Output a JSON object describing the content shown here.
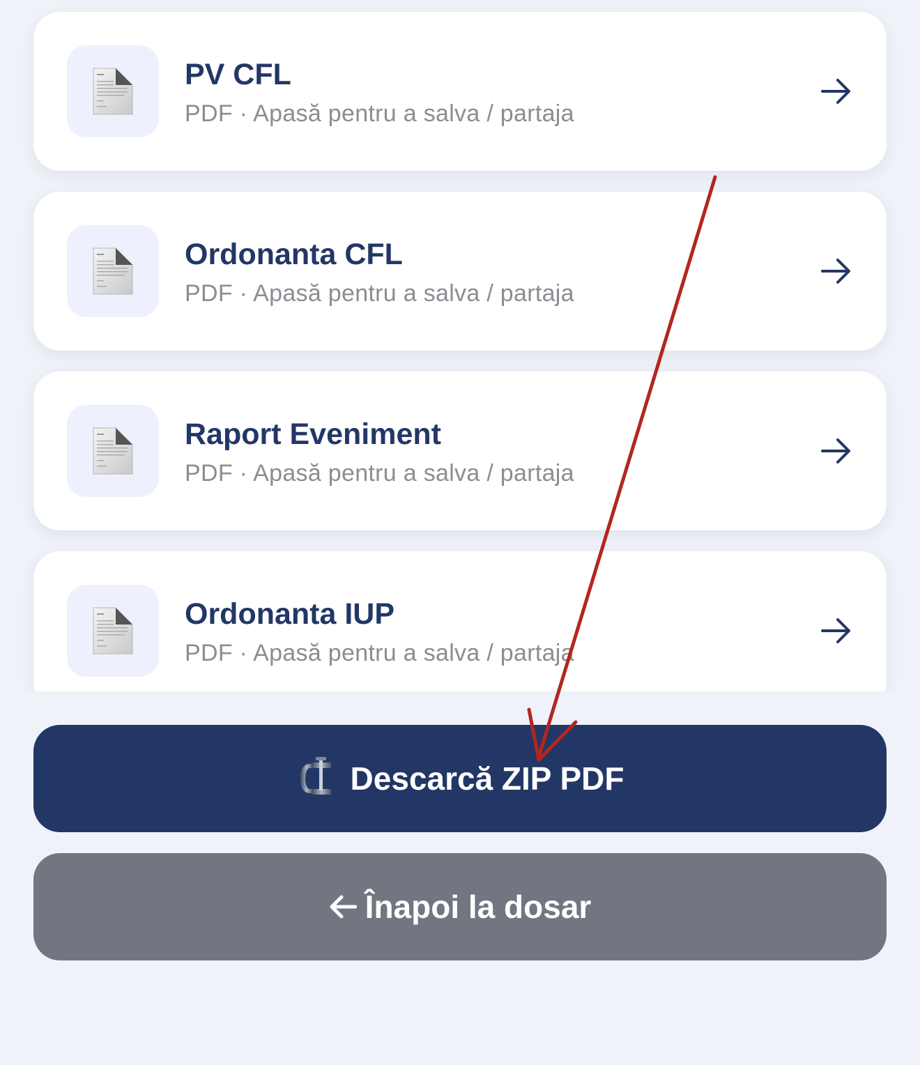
{
  "documents": [
    {
      "title": "PV CFL",
      "subtitle": "PDF · Apasă pentru a salva / partaja"
    },
    {
      "title": "Ordonanta CFL",
      "subtitle": "PDF · Apasă pentru a salva / partaja"
    },
    {
      "title": "Raport Eveniment",
      "subtitle": "PDF · Apasă pentru a salva / partaja"
    },
    {
      "title": "Ordonanta IUP",
      "subtitle": "PDF · Apasă pentru a salva / partaja"
    }
  ],
  "actions": {
    "zip_label": "Descarcă ZIP PDF",
    "zip_icon": "clamp-icon",
    "back_label": "Înapoi la dosar",
    "back_icon": "arrow-left-icon"
  },
  "icons": {
    "document": "document-icon",
    "row_arrow": "arrow-right-icon"
  },
  "colors": {
    "background": "#eff2f8",
    "card": "#ffffff",
    "icon_tile": "#eef1fd",
    "title": "#233766",
    "subtitle": "#8a8d92",
    "primary_button": "#233766",
    "secondary_button": "#717680",
    "annotation_arrow": "#b3261e"
  }
}
